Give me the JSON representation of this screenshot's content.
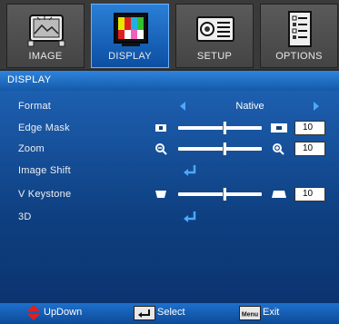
{
  "tabs": [
    {
      "label": "IMAGE",
      "icon": "image-landscape-icon",
      "active": false
    },
    {
      "label": "DISPLAY",
      "icon": "color-bars-icon",
      "active": true
    },
    {
      "label": "SETUP",
      "icon": "projector-icon",
      "active": false
    },
    {
      "label": "OPTIONS",
      "icon": "checklist-icon",
      "active": false
    }
  ],
  "section_title": "DISPLAY",
  "rows": {
    "format": {
      "label": "Format",
      "value": "Native"
    },
    "edge_mask": {
      "label": "Edge Mask",
      "value": "10",
      "level": 0.55
    },
    "zoom": {
      "label": "Zoom",
      "value": "10",
      "level": 0.55
    },
    "image_shift": {
      "label": "Image Shift"
    },
    "v_keystone": {
      "label": "V Keystone",
      "value": "10",
      "level": 0.55
    },
    "three_d": {
      "label": "3D"
    }
  },
  "footer": {
    "updown": "UpDown",
    "select": "Select",
    "exit": "Exit",
    "menu_key": "Menu"
  },
  "colors": {
    "accent": "#2e84dd",
    "arrow": "#4da8ff",
    "updown_arrow": "#e02020"
  }
}
